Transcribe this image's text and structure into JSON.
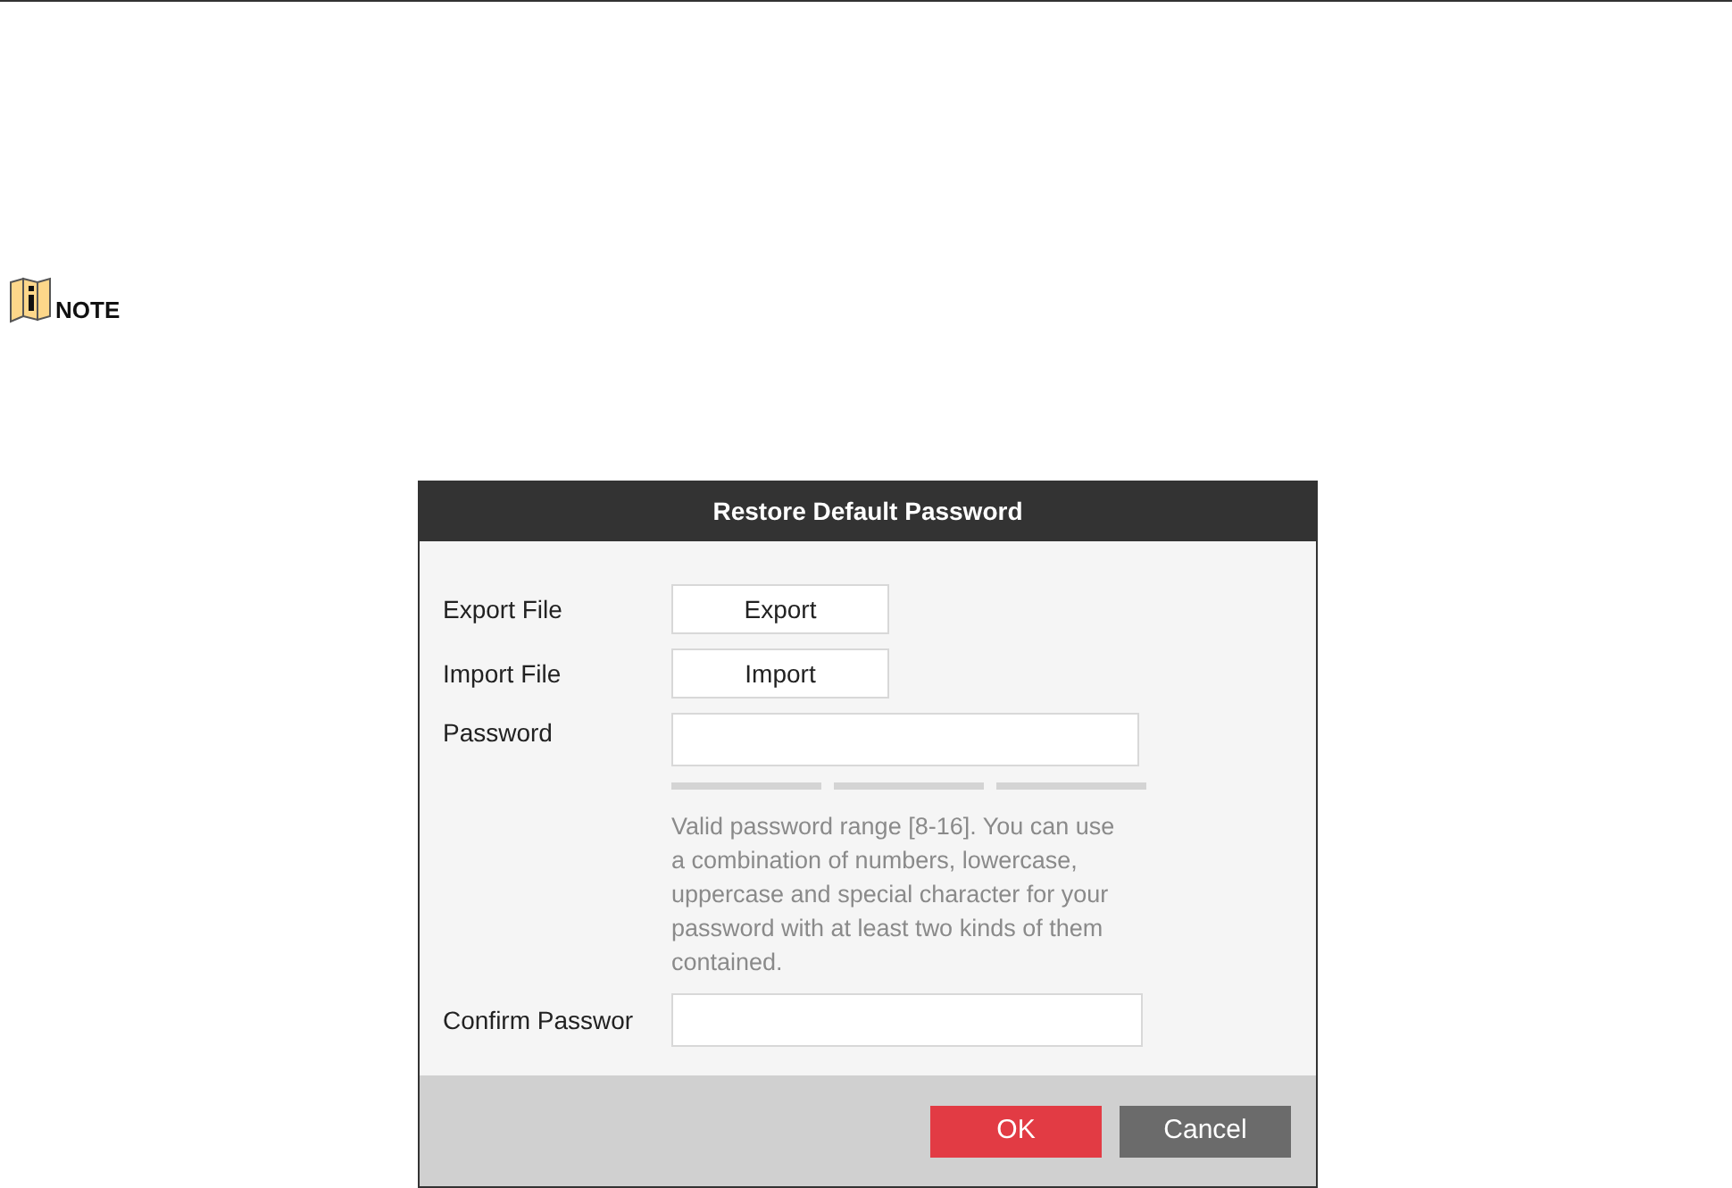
{
  "note": {
    "label": "NOTE"
  },
  "dialog": {
    "title": "Restore Default Password",
    "rows": [
      {
        "kind": "button",
        "label": "Export File",
        "button": "Export"
      },
      {
        "kind": "button",
        "label": "Import File",
        "button": "Import"
      },
      {
        "kind": "password",
        "label": "Password",
        "hint": "Valid password range [8-16]. You can use a combination of numbers, lowercase, uppercase and special character for your password with at least two kinds of them contained."
      },
      {
        "kind": "field",
        "label": "Confirm Passwor"
      }
    ],
    "buttons": [
      {
        "label": "OK",
        "primary": true
      },
      {
        "label": "Cancel",
        "primary": false
      }
    ]
  }
}
